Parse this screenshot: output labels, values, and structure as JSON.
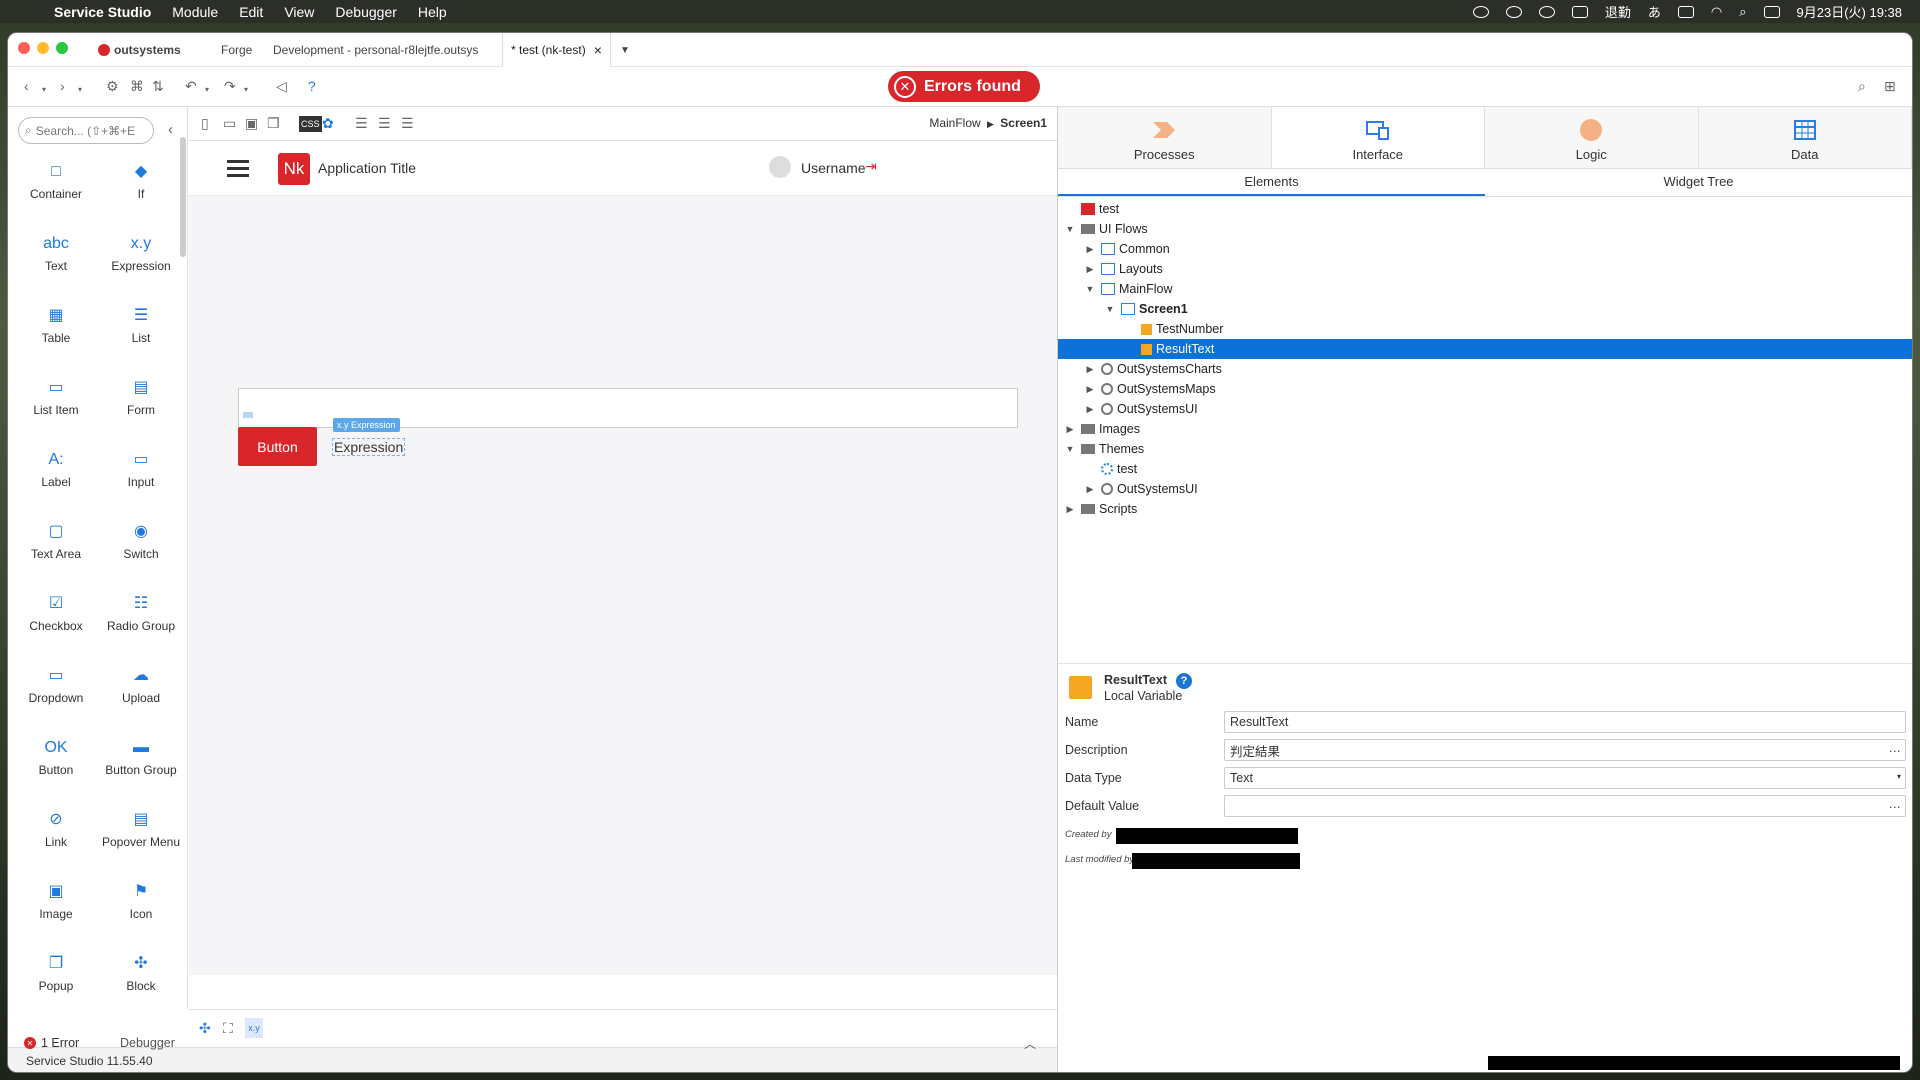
{
  "menubar": {
    "app": "Service Studio",
    "items": [
      "Module",
      "Edit",
      "View",
      "Debugger",
      "Help"
    ],
    "indicators": [
      "退勤",
      "あ"
    ],
    "clock": "9月23日(火) 19:38"
  },
  "tabs": {
    "brand": "outsystems",
    "forge": "Forge",
    "env": "Development - personal-r8lejtfe.outsys",
    "module": "* test (nk-test)"
  },
  "errors": {
    "label": "Errors found"
  },
  "palette": {
    "search_placeholder": "Search... (⇧+⌘+E",
    "widgets": [
      {
        "l": "Container",
        "i": "□"
      },
      {
        "l": "If",
        "i": "◆"
      },
      {
        "l": "Text",
        "i": "abc"
      },
      {
        "l": "Expression",
        "i": "x.y"
      },
      {
        "l": "Table",
        "i": "▦"
      },
      {
        "l": "List",
        "i": "☰"
      },
      {
        "l": "List Item",
        "i": "▭"
      },
      {
        "l": "Form",
        "i": "▤"
      },
      {
        "l": "Label",
        "i": "A:"
      },
      {
        "l": "Input",
        "i": "▭"
      },
      {
        "l": "Text Area",
        "i": "▢"
      },
      {
        "l": "Switch",
        "i": "◉"
      },
      {
        "l": "Checkbox",
        "i": "☑"
      },
      {
        "l": "Radio Group",
        "i": "☷"
      },
      {
        "l": "Dropdown",
        "i": "▭"
      },
      {
        "l": "Upload",
        "i": "☁"
      },
      {
        "l": "Button",
        "i": "OK"
      },
      {
        "l": "Button Group",
        "i": "▬"
      },
      {
        "l": "Link",
        "i": "⊘"
      },
      {
        "l": "Popover Menu",
        "i": "▤"
      },
      {
        "l": "Image",
        "i": "▣"
      },
      {
        "l": "Icon",
        "i": "⚑"
      },
      {
        "l": "Popup",
        "i": "❐"
      },
      {
        "l": "Block",
        "i": "✣"
      }
    ]
  },
  "canvas": {
    "breadcrumb_flow": "MainFlow",
    "breadcrumb_screen": "Screen1",
    "app_initials": "Nk",
    "app_title": "Application Title",
    "username": "Username",
    "button_label": "Button",
    "expression_tag": "x.y Expression",
    "expression_text": "Expression",
    "bottom_tag": "x.y"
  },
  "status": {
    "errors": "1 Error",
    "debugger": "Debugger",
    "version": "Service Studio 11.55.40"
  },
  "right": {
    "tabs": [
      "Processes",
      "Interface",
      "Logic",
      "Data"
    ],
    "subtabs": [
      "Elements",
      "Widget Tree"
    ],
    "tree": [
      {
        "t": "test",
        "d": 0,
        "a": "",
        "ic": "nk"
      },
      {
        "t": "UI Flows",
        "d": 0,
        "a": "▼",
        "ic": "folder"
      },
      {
        "t": "Common",
        "d": 1,
        "a": "▶",
        "ic": "flow"
      },
      {
        "t": "Layouts",
        "d": 1,
        "a": "▶",
        "ic": "flow"
      },
      {
        "t": "MainFlow",
        "d": 1,
        "a": "▼",
        "ic": "flow"
      },
      {
        "t": "Screen1",
        "d": 2,
        "a": "▼",
        "ic": "screen",
        "b": true
      },
      {
        "t": "TestNumber",
        "d": 3,
        "a": "",
        "ic": "var"
      },
      {
        "t": "ResultText",
        "d": 3,
        "a": "",
        "ic": "var",
        "sel": true
      },
      {
        "t": "OutSystemsCharts",
        "d": 1,
        "a": "▶",
        "ic": "ref"
      },
      {
        "t": "OutSystemsMaps",
        "d": 1,
        "a": "▶",
        "ic": "ref"
      },
      {
        "t": "OutSystemsUI",
        "d": 1,
        "a": "▶",
        "ic": "ref"
      },
      {
        "t": "Images",
        "d": 0,
        "a": "▶",
        "ic": "folder"
      },
      {
        "t": "Themes",
        "d": 0,
        "a": "▼",
        "ic": "folder"
      },
      {
        "t": "test",
        "d": 1,
        "a": "",
        "ic": "theme"
      },
      {
        "t": "OutSystemsUI",
        "d": 1,
        "a": "▶",
        "ic": "ref"
      },
      {
        "t": "Scripts",
        "d": 0,
        "a": "▶",
        "ic": "folder"
      }
    ],
    "props": {
      "title": "ResultText",
      "subtitle": "Local Variable",
      "name_label": "Name",
      "name": "ResultText",
      "desc_label": "Description",
      "desc": "判定結果",
      "type_label": "Data Type",
      "type": "Text",
      "default_label": "Default Value",
      "default": "",
      "created": "Created by",
      "modified": "Last modified by"
    }
  },
  "colors": {
    "accent": "#0b72d9",
    "error": "#d8262a",
    "var": "#f5a623"
  }
}
